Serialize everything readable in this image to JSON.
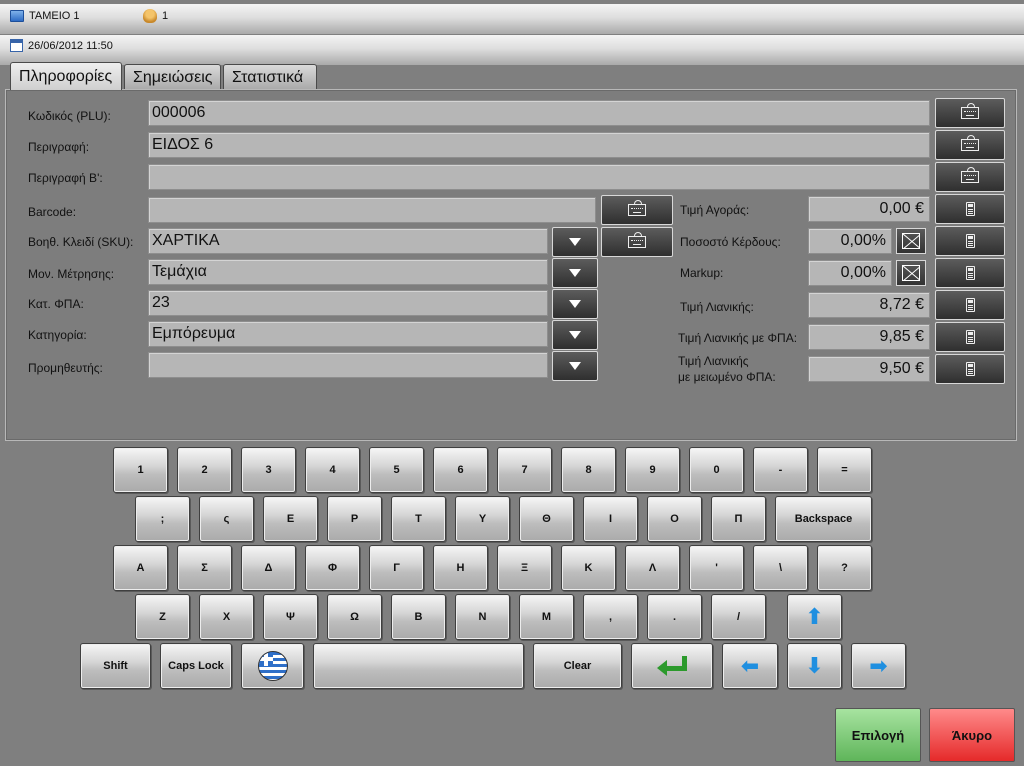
{
  "header": {
    "register": "ΤΑΜΕΙΟ 1",
    "user": "1",
    "datetime": "26/06/2012 11:50"
  },
  "tabs": [
    {
      "label": "Πληροφορίες",
      "active": true
    },
    {
      "label": "Σημειώσεις",
      "active": false
    },
    {
      "label": "Στατιστικά",
      "active": false
    }
  ],
  "form": {
    "code": {
      "label": "Κωδικός (PLU):",
      "value": "000006"
    },
    "description": {
      "label": "Περιγραφή:",
      "value": "ΕΙΔΟΣ 6"
    },
    "description_b": {
      "label": "Περιγραφή Β':",
      "value": ""
    },
    "barcode": {
      "label": "Barcode:",
      "value": ""
    },
    "sku": {
      "label": "Βοηθ. Κλειδί (SKU):",
      "value": "ΧΑΡΤΙΚΑ"
    },
    "unit": {
      "label": "Μον. Μέτρησης:",
      "value": "Τεμάχια"
    },
    "vat": {
      "label": "Κατ. ΦΠΑ:",
      "value": "23"
    },
    "category": {
      "label": "Κατηγορία:",
      "value": "Εμπόρευμα"
    },
    "supplier": {
      "label": "Προμηθευτής:",
      "value": ""
    }
  },
  "pricing": {
    "purchase": {
      "label": "Τιμή Αγοράς:",
      "value": "0,00 €"
    },
    "profit_pct": {
      "label": "Ποσοστό Κέρδους:",
      "value": "0,00%"
    },
    "markup": {
      "label": "Markup:",
      "value": "0,00%"
    },
    "retail": {
      "label": "Τιμή Λιανικής:",
      "value": "8,72 €"
    },
    "retail_vat": {
      "label": "Τιμή Λιανικής με ΦΠΑ:",
      "value": "9,85 €"
    },
    "retail_reduced_l1": "Τιμή Λιανικής",
    "retail_reduced_l2": "με μειωμένο ΦΠΑ:",
    "retail_reduced_value": "9,50 €"
  },
  "keyboard": {
    "row1": [
      "1",
      "2",
      "3",
      "4",
      "5",
      "6",
      "7",
      "8",
      "9",
      "0",
      "-",
      "="
    ],
    "row2": [
      ";",
      "ς",
      "Ε",
      "Ρ",
      "Τ",
      "Υ",
      "Θ",
      "Ι",
      "Ο",
      "Π",
      "Backspace"
    ],
    "row3": [
      "Α",
      "Σ",
      "Δ",
      "Φ",
      "Γ",
      "Η",
      "Ξ",
      "Κ",
      "Λ",
      "'",
      "\\",
      "?"
    ],
    "row4": [
      "Ζ",
      "Χ",
      "Ψ",
      "Ω",
      "Β",
      "Ν",
      "Μ",
      ",",
      ".",
      "/"
    ],
    "shift": "Shift",
    "caps": "Caps Lock",
    "clear": "Clear"
  },
  "actions": {
    "ok": "Επιλογή",
    "cancel": "Άκυρο"
  }
}
